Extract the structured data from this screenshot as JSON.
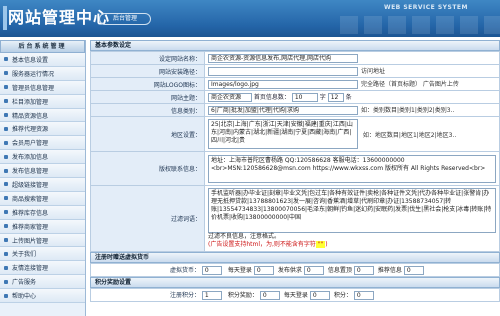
{
  "header": {
    "title": "网站管理中心",
    "subtitle": "后台管理",
    "service": "WEB SERVICE SYSTEM",
    "gradient_top": "#3f87c4",
    "gradient_bottom": "#1c5592"
  },
  "sidebar": {
    "title": "后台系统管理",
    "items": [
      {
        "label": "基本信息设置"
      },
      {
        "label": "服务器运行情况"
      },
      {
        "label": "管理员信息管理"
      },
      {
        "label": "栏目添加管理"
      },
      {
        "label": "精品资源信息"
      },
      {
        "label": "推荐代理资源"
      },
      {
        "label": "会员用户管理"
      },
      {
        "label": "发布添加信息"
      },
      {
        "label": "发布信息管理"
      },
      {
        "label": "超级链接管理"
      },
      {
        "label": "商品搜索管理"
      },
      {
        "label": "推荐库存信息"
      },
      {
        "label": "推荐商家管理"
      },
      {
        "label": "上传图片管理"
      },
      {
        "label": "关于我们"
      },
      {
        "label": "友情连接管理"
      },
      {
        "label": "广告服务"
      },
      {
        "label": "帮助中心"
      }
    ]
  },
  "main": {
    "section_basic": "基本参数设定",
    "site_name_label": "设定网站名称：",
    "site_name_value": "商企农资源-资源信息发布,网店代理,网店代购",
    "site_url_label": "网站安装路径：",
    "site_url_value": "",
    "site_url_hint": "访问地址",
    "logo_label": "网站LOGO图标：",
    "logo_value": "Images/logo.jpg",
    "logo_hint": "完全路径（首页标题）  广告图片上传",
    "theme_label": "网站主题：",
    "theme_value": "商企农资源",
    "first_rows_label": "首页信息数：",
    "first_rows_value": "10",
    "first_rows_unit": "字",
    "first_rows_value2": "12",
    "first_rows_unit2": "条",
    "category_label": "信息类别：",
    "category_value": "6|厂商|批发|加盟|代理|代购|求购",
    "category_note": "如：类别数目|类别1|类别2|类别3..",
    "region_label": "地区设置：",
    "region_value": "25|北京|上海|广东|浙江|天津|安徽|福建|重庆|江西|山东|河南|内蒙古|湖北|新疆|湖南|宁夏|西藏|海南|广西|四川|河北|贵",
    "region_note": "如：地区数目|地区1|地区2|地区3..",
    "contact_label": "版权联系信息：",
    "contact_value": "地址：上海市普陀区曹杨路  QQ:120586628  客服电话：13600000000 <br>MSN:120586628@msn.com  https://www.wkxss.com  版权所有 All Rights Reserved<br>",
    "filter_label": "过滤词语：",
    "filter_value": "手机监听器|办毕业证|刻章|毕业文凭|包过车|各种有效证件|卖枪|各种证件文凭|代办各种毕业证|张警肯|办理无抵押贷款|13788801623|发一展|咨询|香蕉酒|增草|代刷印章|办证|13588734057|转账|13554734833|13800070056|毛泽东|朝鲜|钓鱼|迷幻药|安眠药|发票|伐生|黑社会|枪支|冰毒|转账|特价机票|收购|13800000000|中国",
    "filter_hint": "过滤不良信息，注意格式。",
    "filter_note_pre": "(广告设置支持html，为,则不能含有字符",
    "filter_note_hl": " \"\" ",
    "filter_note_post": ")",
    "section_points": "注册时赠送虚拟货币",
    "points_label": "虚拟货币：",
    "points_value": "0",
    "points_items": [
      {
        "label": "每天登录",
        "value": "0"
      },
      {
        "label": "发布供求",
        "value": "0"
      },
      {
        "label": "信息置顶",
        "value": "0"
      },
      {
        "label": "推荐信息",
        "value": "0"
      }
    ],
    "section_rewards": "积分奖励设置",
    "rewards_label": "注册积分：",
    "rewards_value": "1",
    "rewards_items": [
      {
        "label": "积分奖励：",
        "value": "0"
      },
      {
        "label": "每天登录",
        "value": "0"
      },
      {
        "label": "积分：",
        "value": "0"
      }
    ],
    "accent": "#2465a8",
    "note_color": "#cc1111"
  }
}
